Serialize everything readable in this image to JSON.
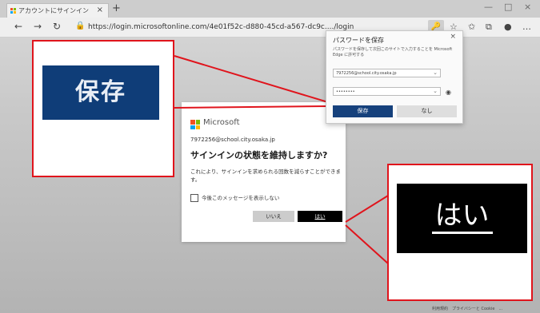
{
  "browser": {
    "tab_title": "アカウントにサインイン",
    "tab_close": "×",
    "new_tab": "+",
    "url": "https://login.microsoftonline.com/4e01f52c-d880-45cd-a567-dc9c..../login",
    "win_min": "—",
    "win_max": "□",
    "win_close": "×"
  },
  "password_popup": {
    "title": "パスワードを保存",
    "close": "×",
    "description": "パスワードを保存して次回このサイトで入力することを Microsoft Edge に許可する",
    "username": "7972256@school.city.osaka.jp",
    "password": "••••••••",
    "save_label": "保存",
    "no_label": "なし"
  },
  "dialog": {
    "brand": "Microsoft",
    "email": "7972256@school.city.osaka.jp",
    "heading": "サインインの状態を維持しますか?",
    "body": "これにより、サインインを求められる回数を減らすことができます。",
    "checkbox_label": "今後このメッセージを表示しない",
    "no_button": "いいえ",
    "yes_button": "はい"
  },
  "callouts": {
    "save_zoom": "保存",
    "yes_zoom": "はい"
  },
  "footer": "利用規約　プライバシーと Cookie　...",
  "colors": {
    "accent_blue": "#16417c",
    "callout_red": "#e0141c",
    "ms_red": "#f25022",
    "ms_green": "#7fba00",
    "ms_blue": "#00a4ef",
    "ms_yellow": "#ffb900"
  }
}
